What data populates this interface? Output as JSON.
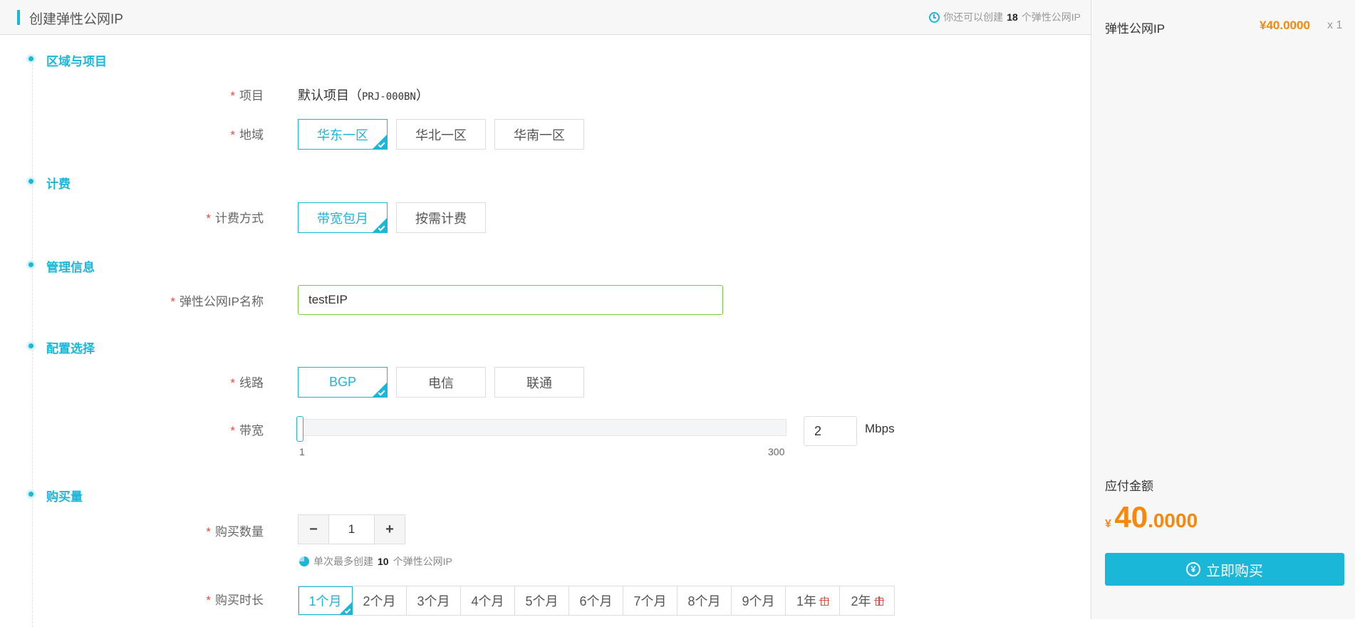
{
  "header": {
    "title": "创建弹性公网IP",
    "quota_prefix": "你还可以创建",
    "quota_count": "18",
    "quota_suffix": "个弹性公网IP"
  },
  "sections": {
    "region_project": "区域与项目",
    "billing": "计费",
    "management": "管理信息",
    "config": "配置选择",
    "purchase": "购买量"
  },
  "project": {
    "label": "项目",
    "value": "默认项目（",
    "code": "PRJ-000BN",
    "close": "）"
  },
  "region": {
    "label": "地域",
    "options": [
      "华东一区",
      "华北一区",
      "华南一区"
    ],
    "selected": "华东一区"
  },
  "billing_mode": {
    "label": "计费方式",
    "options": [
      "带宽包月",
      "按需计费"
    ],
    "selected": "带宽包月"
  },
  "eip_name": {
    "label": "弹性公网IP名称",
    "value": "testEIP"
  },
  "line": {
    "label": "线路",
    "options": [
      "BGP",
      "电信",
      "联通"
    ],
    "selected": "BGP"
  },
  "bandwidth": {
    "label": "带宽",
    "min": "1",
    "max": "300",
    "value": "2",
    "unit": "Mbps"
  },
  "quantity": {
    "label": "购买数量",
    "minus": "−",
    "plus": "+",
    "value": "1",
    "hint_prefix": "单次最多创建",
    "hint_count": "10",
    "hint_suffix": "个弹性公网IP"
  },
  "duration": {
    "label": "购买时长",
    "options": [
      "1个月",
      "2个月",
      "3个月",
      "4个月",
      "5个月",
      "6个月",
      "7个月",
      "8个月",
      "9个月",
      "1年",
      "2年"
    ],
    "selected": "1个月"
  },
  "summary": {
    "item": "弹性公网IP",
    "price": "¥40.0000",
    "qty": "x 1",
    "pay_label": "应付金额",
    "currency": "¥",
    "amount_int": "40",
    "amount_dec": ".0000",
    "buy_label": "立即购买"
  },
  "colors": {
    "accent": "#1ab7d9",
    "price": "#f7880b",
    "required": "#e84a3d",
    "valid_border": "#7ac943"
  }
}
